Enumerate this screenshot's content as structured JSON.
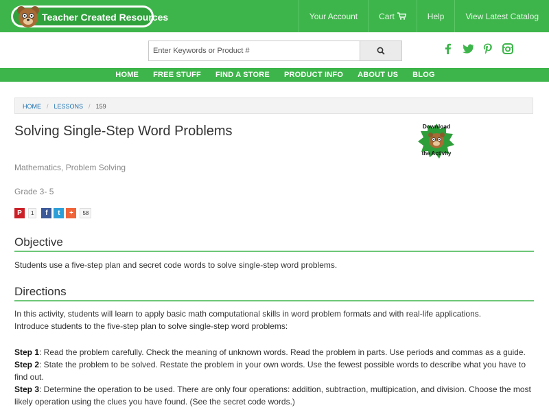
{
  "header": {
    "logo_text": "Teacher Created Resources",
    "nav": {
      "account": "Your Account",
      "cart": "Cart",
      "help": "Help",
      "catalog": "View Latest Catalog"
    }
  },
  "search": {
    "placeholder": "Enter Keywords or Product #"
  },
  "social_icons": [
    "facebook-icon",
    "twitter-icon",
    "pinterest-icon",
    "instagram-icon"
  ],
  "main_nav": [
    "HOME",
    "FREE STUFF",
    "FIND A STORE",
    "PRODUCT INFO",
    "ABOUT US",
    "BLOG"
  ],
  "breadcrumb": {
    "home": "HOME",
    "lessons": "LESSONS",
    "current": "159"
  },
  "lesson": {
    "title": "Solving Single-Step Word Problems",
    "download_badge": {
      "line1": "Download",
      "line2": "the Activity"
    },
    "subject": "Mathematics, Problem Solving",
    "grade": "Grade 3- 5",
    "share": {
      "pinterest_count": "1",
      "total_count": "58"
    }
  },
  "objective": {
    "heading": "Objective",
    "text": "Students use a five-step plan and secret code words to solve single-step word problems."
  },
  "directions": {
    "heading": "Directions",
    "intro1": "In this activity, students will learn to apply basic math computational skills in word problem formats and with real-life applications.",
    "intro2": "Introduce students to the five-step plan to solve single-step word problems:",
    "steps": [
      {
        "label": "Step 1",
        "text": ": Read the problem carefully. Check the meaning of unknown words. Read the problem in parts. Use periods and commas as a guide."
      },
      {
        "label": "Step 2",
        "text": ": State the problem to be solved. Restate the problem in your own words. Use the fewest possible words to describe what you have to find out."
      },
      {
        "label": "Step 3",
        "text": ": Determine the operation to be used. There are only four operations: addition, subtraction, multipication, and division. Choose the most likely operation using the clues you have found. (See the secret code words.)"
      }
    ]
  },
  "colors": {
    "brand_green": "#3db54a",
    "link_blue": "#1a6fb0"
  }
}
